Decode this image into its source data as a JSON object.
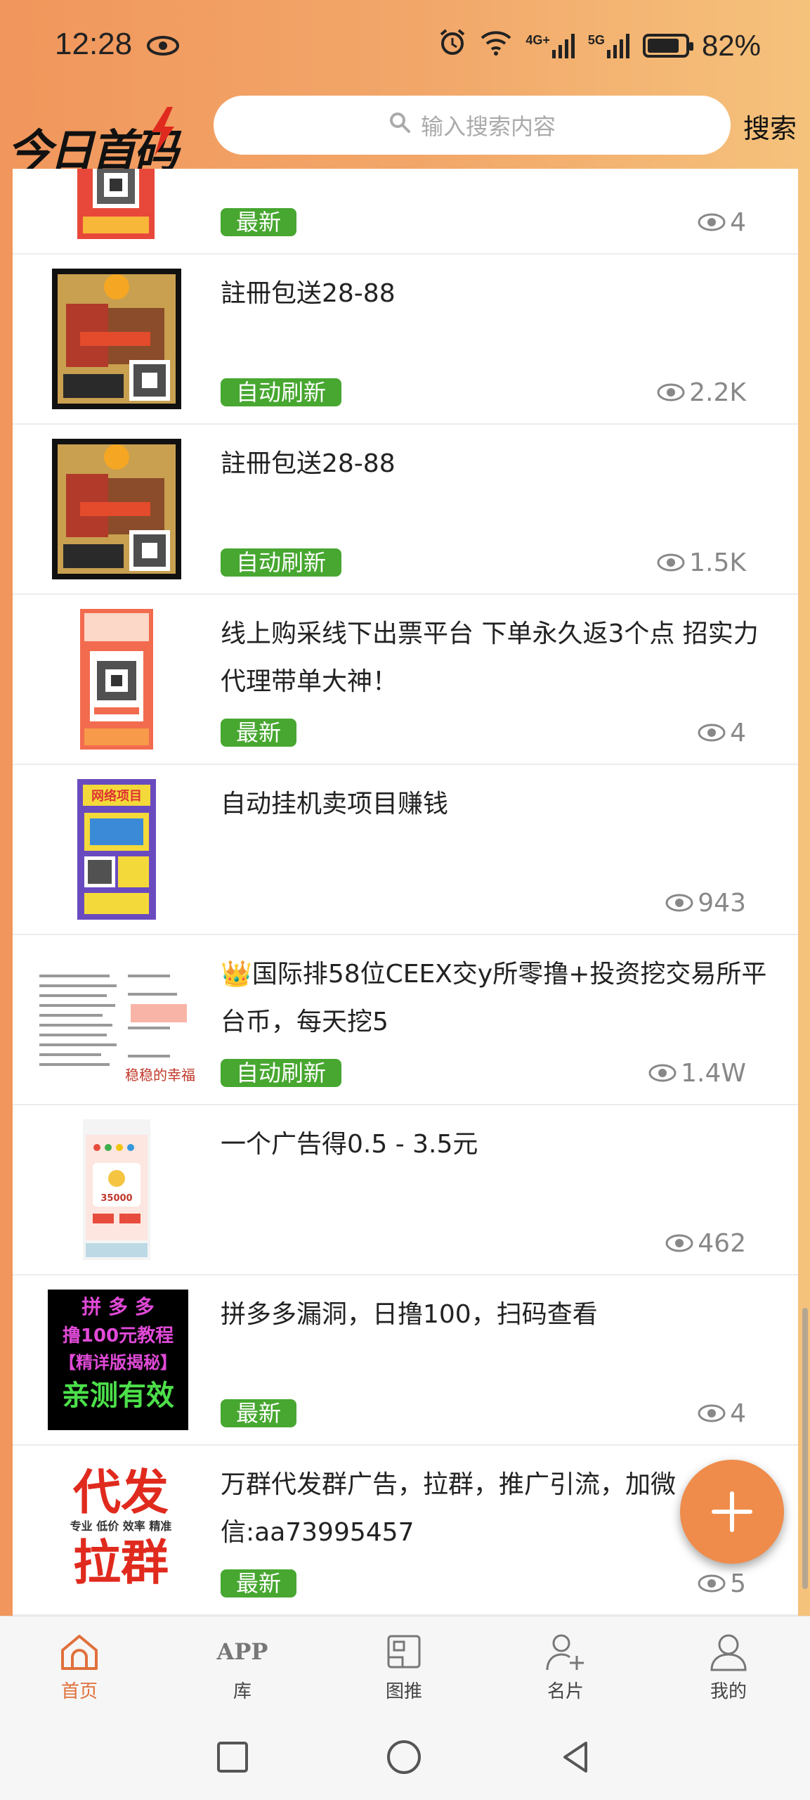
{
  "status_bar": {
    "time": "12:28",
    "signal_4g": "4G+",
    "signal_5g": "5G",
    "battery": "82%",
    "battery_level": 0.82
  },
  "header": {
    "logo_text": "今日首码",
    "search_placeholder": "输入搜索内容",
    "search_button": "搜索"
  },
  "colors": {
    "accent": "#ef8c4b",
    "badge_green": "#47a730",
    "nav_active": "#e0703c"
  },
  "items": [
    {
      "title": "",
      "badge": "最新",
      "views": "4",
      "thumb": "qr-poster-red"
    },
    {
      "title": "註冊包送28-88",
      "badge": "自动刷新",
      "views": "2.2K",
      "thumb": "game-poster"
    },
    {
      "title": "註冊包送28-88",
      "badge": "自动刷新",
      "views": "1.5K",
      "thumb": "game-poster"
    },
    {
      "title": "线上购采线下出票平台 下单永久返3个点 招实力代理带单大神！",
      "badge": "最新",
      "views": "4",
      "thumb": "lottery-poster"
    },
    {
      "title": "自动挂机卖项目赚钱",
      "badge": "",
      "views": "943",
      "thumb": "purple-poster"
    },
    {
      "title": "👑国际排58位CEEX交y所零撸+投资挖交易所平台币，每天挖5",
      "badge": "自动刷新",
      "views": "1.4W",
      "thumb": "document-screenshot"
    },
    {
      "title": "一个广告得0.5 - 3.5元",
      "badge": "",
      "views": "462",
      "thumb": "phone-screenshot"
    },
    {
      "title": "拼多多漏洞，日撸100，扫码查看",
      "badge": "最新",
      "views": "4",
      "thumb": "pdd-poster"
    },
    {
      "title": "万群代发群广告，拉群，推广引流，加微信:aa73995457",
      "badge": "最新",
      "views": "5",
      "thumb": "daifa-poster"
    }
  ],
  "thumb_text": {
    "pdd_line1": "拼 多 多",
    "pdd_line2": "撸100元教程",
    "pdd_line3": "【精详版揭秘】",
    "pdd_line4": "亲测有效",
    "daifa_line1": "代发",
    "daifa_sub": "专业 低价 效率 精准",
    "daifa_line2": "拉群",
    "doc_watermark": "稳稳的幸福",
    "phone_amount": "35000",
    "purple_title": "网络项目"
  },
  "bottom_nav": [
    {
      "label": "首页",
      "icon": "home-icon",
      "active": true
    },
    {
      "label": "库",
      "icon_text": "APP",
      "icon": "app-icon",
      "active": false
    },
    {
      "label": "图推",
      "icon": "image-icon",
      "active": false
    },
    {
      "label": "名片",
      "icon": "add-contact-icon",
      "active": false
    },
    {
      "label": "我的",
      "icon": "profile-icon",
      "active": false
    }
  ],
  "system_nav": [
    "recents-icon",
    "home-circle-icon",
    "back-icon"
  ]
}
